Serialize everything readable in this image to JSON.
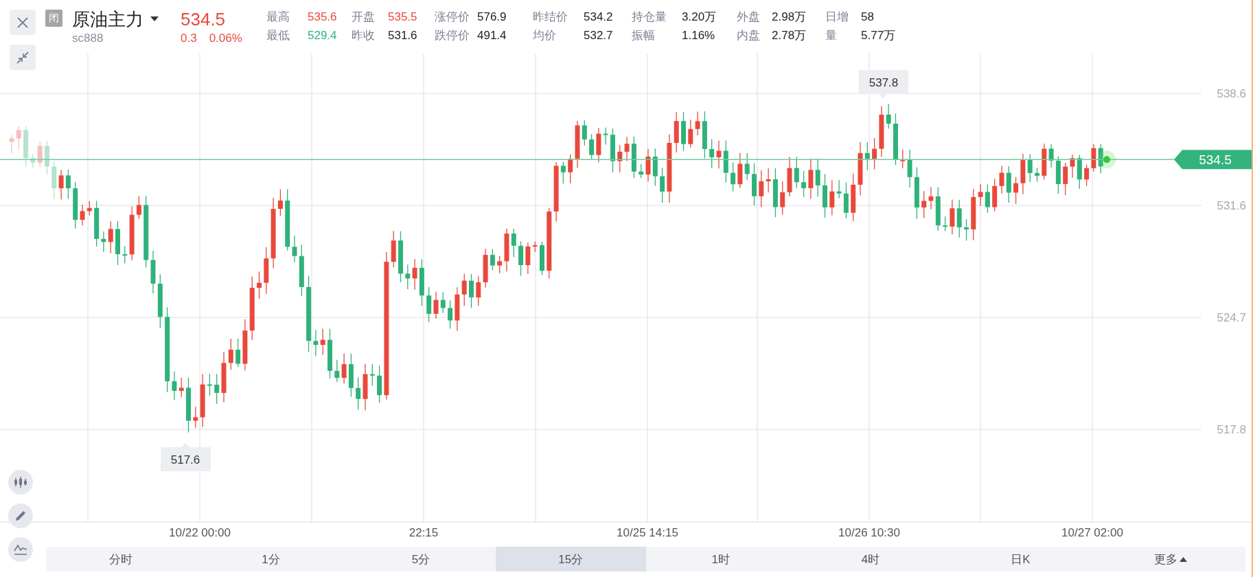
{
  "header": {
    "status_badge": "闭",
    "name": "原油主力",
    "code": "sc888",
    "price": "534.5",
    "change": "0.3",
    "change_pct": "0.06%",
    "color": "#e8493c"
  },
  "stats": [
    [
      {
        "label": "最高",
        "value": "535.6",
        "color": "#e8493c"
      },
      {
        "label": "开盘",
        "value": "535.5",
        "color": "#e8493c"
      },
      {
        "label": "涨停价",
        "value": "576.9",
        "color": "#222222"
      },
      {
        "label": "昨结价",
        "value": "534.2",
        "color": "#222222"
      },
      {
        "label": "持仓量",
        "value": "3.20万",
        "color": "#222222"
      },
      {
        "label": "外盘",
        "value": "2.98万",
        "color": "#222222"
      },
      {
        "label": "日增",
        "value": "58",
        "color": "#222222"
      }
    ],
    [
      {
        "label": "最低",
        "value": "529.4",
        "color": "#2fb27a"
      },
      {
        "label": "昨收",
        "value": "531.6",
        "color": "#222222"
      },
      {
        "label": "跌停价",
        "value": "491.4",
        "color": "#222222"
      },
      {
        "label": "均价",
        "value": "532.7",
        "color": "#222222"
      },
      {
        "label": "振幅",
        "value": "1.16%",
        "color": "#222222"
      },
      {
        "label": "内盘",
        "value": "2.78万",
        "color": "#222222"
      },
      {
        "label": "量",
        "value": "5.77万",
        "color": "#222222"
      }
    ]
  ],
  "chart": {
    "price_axis": [
      "538.6",
      "531.6",
      "524.7",
      "517.8"
    ],
    "time_axis": [
      "10/22 00:00",
      "22:15",
      "10/25 14:15",
      "10/26 10:30",
      "10/27 02:00"
    ],
    "last_price": "534.5",
    "high_marker": "537.8",
    "low_marker": "517.6"
  },
  "timeframes": [
    {
      "label": "分时",
      "selected": false,
      "kind": "tab"
    },
    {
      "label": "1分",
      "selected": false,
      "kind": "tab"
    },
    {
      "label": "5分",
      "selected": false,
      "kind": "tab"
    },
    {
      "label": "15分",
      "selected": true,
      "kind": "tab"
    },
    {
      "label": "1时",
      "selected": false,
      "kind": "tab"
    },
    {
      "label": "4时",
      "selected": false,
      "kind": "tab"
    },
    {
      "label": "日K",
      "selected": false,
      "kind": "tab"
    },
    {
      "label": "更多",
      "selected": false,
      "kind": "more"
    }
  ]
}
